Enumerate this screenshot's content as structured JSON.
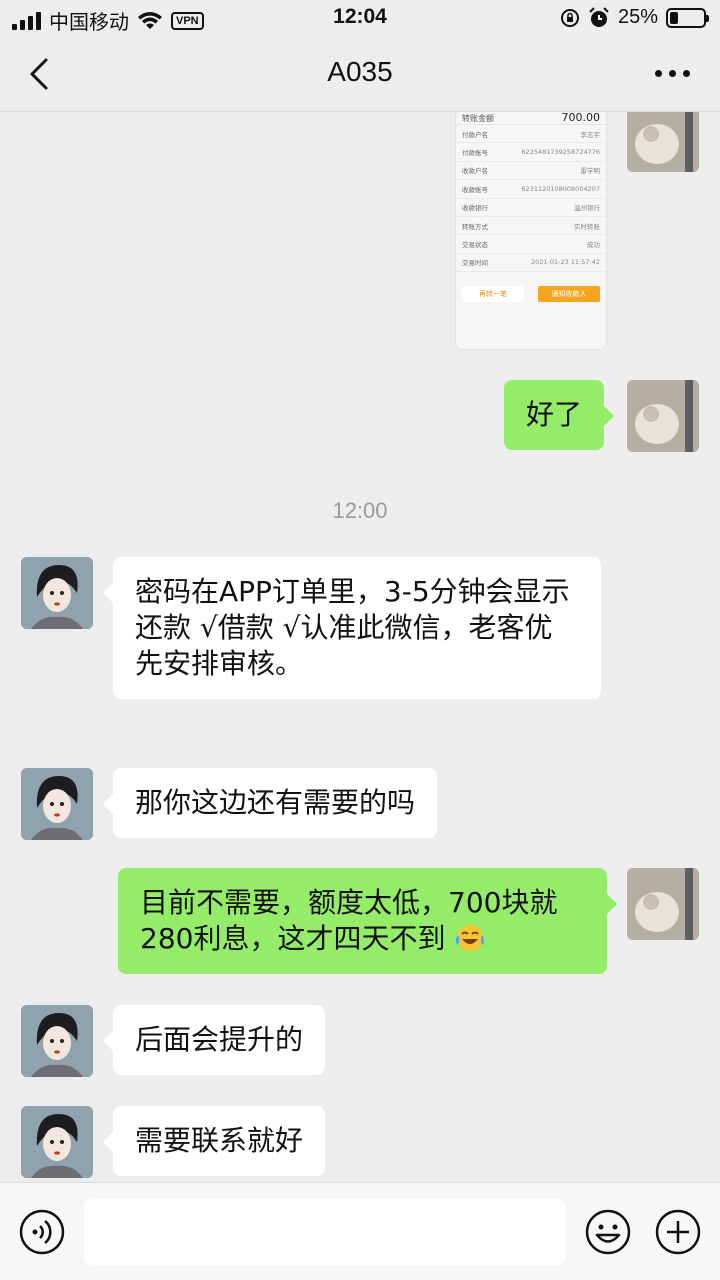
{
  "status_bar": {
    "carrier": "中国移动",
    "vpn": "VPN",
    "time": "12:04",
    "battery_text": "25%",
    "battery_level": 0.25
  },
  "nav": {
    "title": "A035"
  },
  "receipt": {
    "amount_label": "转账金额",
    "amount_value": "700.00",
    "rows": [
      {
        "label": "付款户名",
        "value": "李志宇"
      },
      {
        "label": "付款账号",
        "value": "6225481739258724776"
      },
      {
        "label": "收款户名",
        "value": "雷学明"
      },
      {
        "label": "收款账号",
        "value": "6231120108008004207"
      },
      {
        "label": "收款银行",
        "value": "温州银行"
      },
      {
        "label": "转账方式",
        "value": "实时转账"
      },
      {
        "label": "交易状态",
        "value": "成功"
      },
      {
        "label": "交易时间",
        "value": "2021-01-23 11:57:42"
      }
    ],
    "btn_again": "再转一笔",
    "btn_notify": "通知收款人"
  },
  "messages": {
    "m1": "好了",
    "timestamp": "12:00",
    "m2": "密码在APP订单里，3-5分钟会显示\n还款 √借款 √认准此微信，老客优先安排审核。",
    "m3": "那你这边还有需要的吗",
    "m4": "目前不需要，额度太低，700块就280利息，这才四天不到",
    "m4_emoji": "tears-of-joy-emoji",
    "m5": "后面会提升的",
    "m6": "需要联系就好"
  },
  "colors": {
    "out_bubble": "#95ec69",
    "in_bubble": "#ffffff",
    "background": "#ededed"
  }
}
